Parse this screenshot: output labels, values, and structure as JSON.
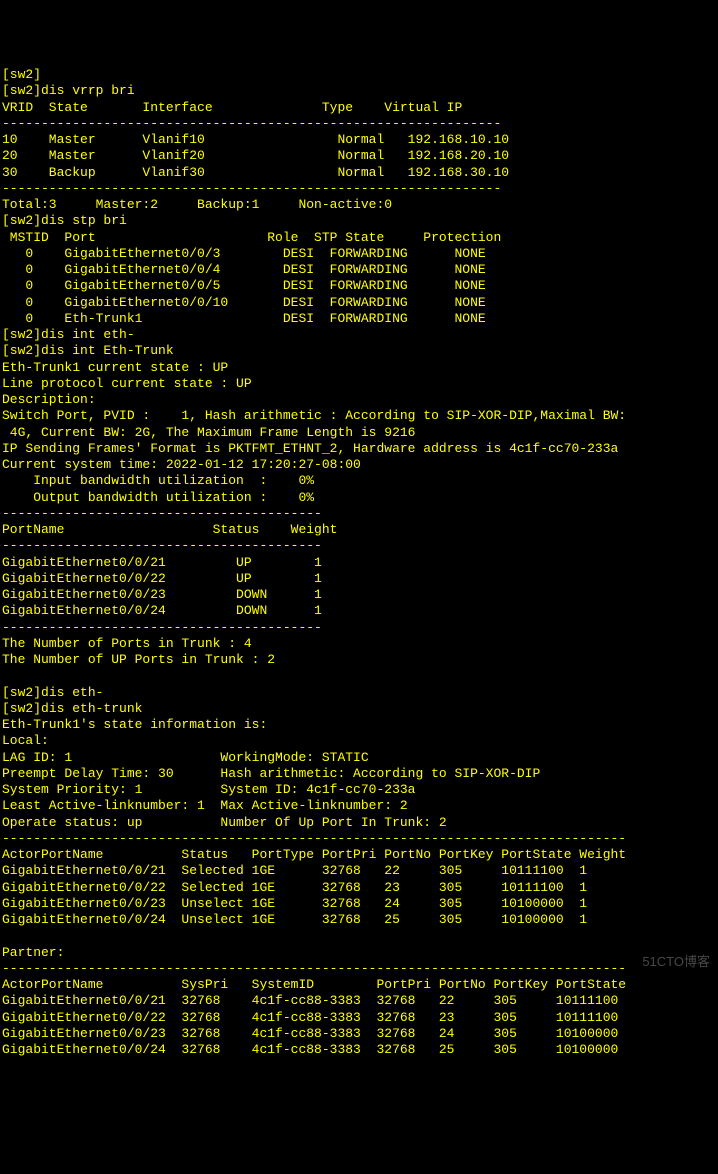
{
  "prompt": "[sw2]",
  "cmd_vrrp": "dis vrrp bri",
  "vrrp_header": "VRID  State       Interface              Type    Virtual IP",
  "dash_line_vrrp": "----------------------------------------------------------------",
  "vrrp_rows": [
    "10    Master      Vlanif10                 Normal   192.168.10.10",
    "20    Master      Vlanif20                 Normal   192.168.20.10",
    "30    Backup      Vlanif30                 Normal   192.168.30.10"
  ],
  "vrrp_totals": "Total:3     Master:2     Backup:1     Non-active:0",
  "cmd_stp": "dis stp bri",
  "stp_header": " MSTID  Port                      Role  STP State     Protection",
  "stp_rows": [
    "   0    GigabitEthernet0/0/3        DESI  FORWARDING      NONE",
    "   0    GigabitEthernet0/0/4        DESI  FORWARDING      NONE",
    "   0    GigabitEthernet0/0/5        DESI  FORWARDING      NONE",
    "   0    GigabitEthernet0/0/10       DESI  FORWARDING      NONE",
    "   0    Eth-Trunk1                  DESI  FORWARDING      NONE"
  ],
  "cmd_int1": "dis int eth-",
  "cmd_int2": "dis int Eth-Trunk",
  "trunk_state": "Eth-Trunk1 current state : UP",
  "line_proto": "Line protocol current state : UP",
  "desc_label": "Description:",
  "switch_port1": "Switch Port, PVID :    1, Hash arithmetic : According to SIP-XOR-DIP,Maximal BW:",
  "switch_port2": " 4G, Current BW: 2G, The Maximum Frame Length is 9216",
  "ip_sending": "IP Sending Frames' Format is PKTFMT_ETHNT_2, Hardware address is 4c1f-cc70-233a",
  "sys_time": "Current system time: 2022-01-12 17:20:27-08:00",
  "input_bw": "    Input bandwidth utilization  :    0%",
  "output_bw": "    Output bandwidth utilization :    0%",
  "dash_line_port": "-----------------------------------------",
  "port_header": "PortName                   Status    Weight",
  "port_rows": [
    "GigabitEthernet0/0/21         UP        1",
    "GigabitEthernet0/0/22         UP        1",
    "GigabitEthernet0/0/23         DOWN      1",
    "GigabitEthernet0/0/24         DOWN      1"
  ],
  "num_ports": "The Number of Ports in Trunk : 4",
  "num_up": "The Number of UP Ports in Trunk : 2",
  "cmd_eth1": "dis eth-",
  "cmd_eth2": "dis eth-trunk",
  "trunk_info": "Eth-Trunk1's state information is:",
  "local_label": "Local:",
  "lag_id": "LAG ID: 1                   WorkingMode: STATIC",
  "preempt": "Preempt Delay Time: 30      Hash arithmetic: According to SIP-XOR-DIP",
  "sys_prio": "System Priority: 1          System ID: 4c1f-cc70-233a",
  "active_link": "Least Active-linknumber: 1  Max Active-linknumber: 2",
  "operate": "Operate status: up          Number Of Up Port In Trunk: 2",
  "dash_long": "--------------------------------------------------------------------------------",
  "actor_header": "ActorPortName          Status   PortType PortPri PortNo PortKey PortState Weight",
  "actor_rows": [
    "GigabitEthernet0/0/21  Selected 1GE      32768   22     305     10111100  1",
    "GigabitEthernet0/0/22  Selected 1GE      32768   23     305     10111100  1",
    "GigabitEthernet0/0/23  Unselect 1GE      32768   24     305     10100000  1",
    "GigabitEthernet0/0/24  Unselect 1GE      32768   25     305     10100000  1"
  ],
  "partner_label": "Partner:",
  "partner_header": "ActorPortName          SysPri   SystemID        PortPri PortNo PortKey PortState",
  "partner_rows": [
    "GigabitEthernet0/0/21  32768    4c1f-cc88-3383  32768   22     305     10111100",
    "GigabitEthernet0/0/22  32768    4c1f-cc88-3383  32768   23     305     10111100",
    "GigabitEthernet0/0/23  32768    4c1f-cc88-3383  32768   24     305     10100000",
    "GigabitEthernet0/0/24  32768    4c1f-cc88-3383  32768   25     305     10100000"
  ],
  "watermark": "51CTO博客"
}
